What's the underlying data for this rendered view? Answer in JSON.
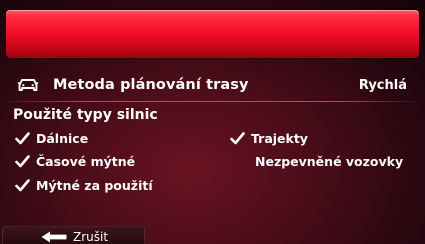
{
  "route_method": {
    "label": "Metoda plánování trasy",
    "value": "Rychlá",
    "icon": "car-icon"
  },
  "road_types": {
    "heading": "Použité typy silnic",
    "options": [
      {
        "label": "Dálnice",
        "checked": true
      },
      {
        "label": "Trajekty",
        "checked": true
      },
      {
        "label": "Časové mýtné",
        "checked": true
      },
      {
        "label": "Nezpevněné vozovky",
        "checked": false
      },
      {
        "label": "Mýtné za použití",
        "checked": true
      }
    ]
  },
  "footer": {
    "cancel_label": "Zrušit",
    "cancel_icon": "back-arrow-icon"
  },
  "colors": {
    "banner_red": "#ef0f26",
    "background": "#4a0d18",
    "text": "#ffffff"
  }
}
